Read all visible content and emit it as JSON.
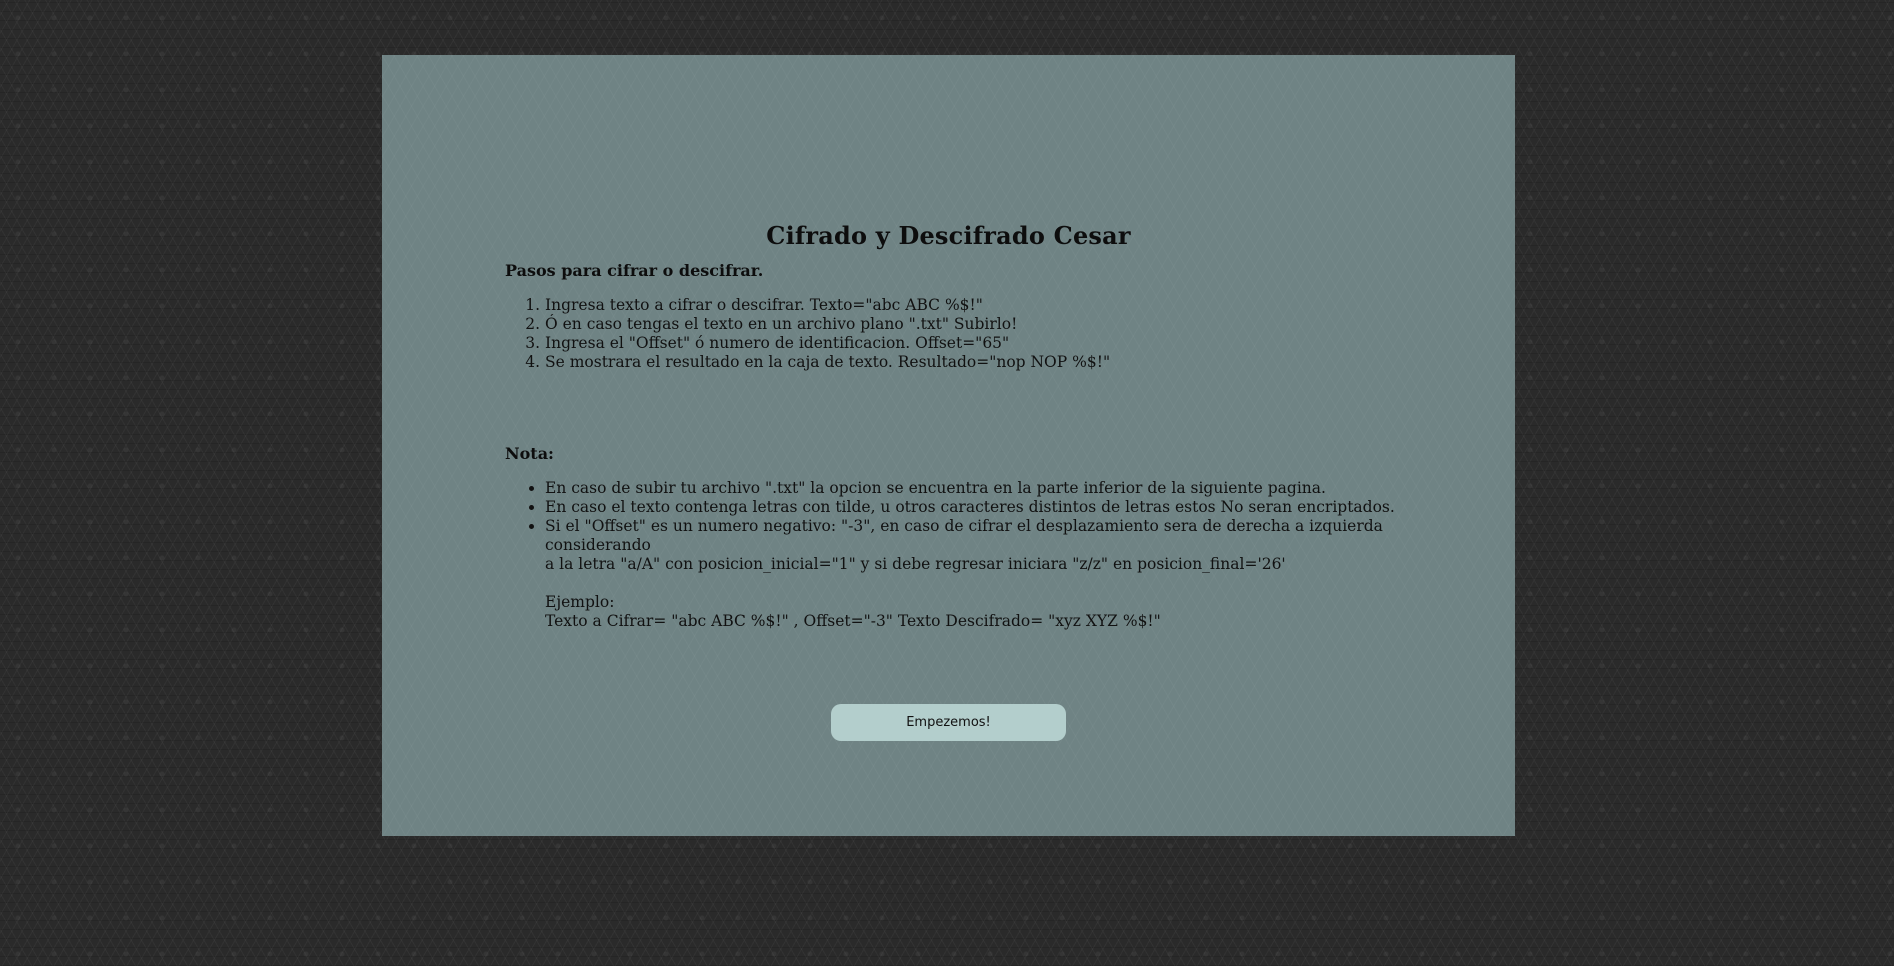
{
  "page": {
    "title": "Cifrado y Descifrado Cesar"
  },
  "steps": {
    "heading": "Pasos para cifrar o descifrar.",
    "items": [
      "Ingresa texto a cifrar o descifrar. Texto=\"abc ABC %$!\"",
      "Ó en caso tengas el texto en un archivo plano \".txt\" Subirlo!",
      "Ingresa el \"Offset\" ó numero de identificacion. Offset=\"65\"",
      "Se mostrara el resultado en la caja de texto. Resultado=\"nop NOP %$!\""
    ]
  },
  "note": {
    "heading": "Nota:",
    "items": [
      "En caso de subir tu archivo \".txt\" la opcion se encuentra en la parte inferior de la siguiente pagina.",
      "En caso el texto contenga letras con tilde, u otros caracteres distintos de letras estos No seran encriptados."
    ],
    "negative_offset": {
      "line1": "Si el \"Offset\" es un numero negativo: \"-3\", en caso de cifrar el desplazamiento sera de derecha a izquierda considerando",
      "line2": "a la letra \"a/A\" con posicion_inicial=\"1\" y si debe regresar iniciara \"z/z\" en posicion_final='26'",
      "example_label": "Ejemplo:",
      "example_text": "Texto a Cifrar= \"abc ABC %$!\" , Offset=\"-3\" Texto Descifrado= \"xyz XYZ %$!\""
    }
  },
  "cta": {
    "label": "Empezemos!"
  }
}
